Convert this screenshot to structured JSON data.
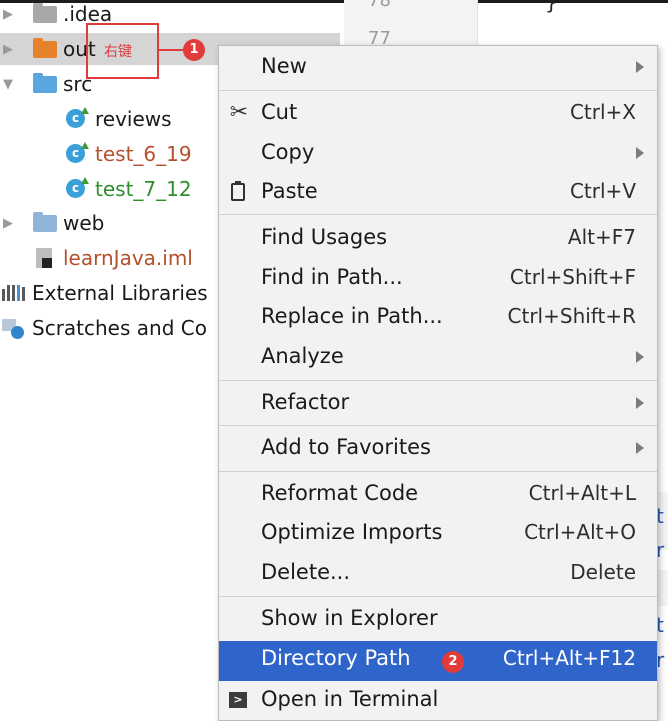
{
  "tree": {
    "items": [
      {
        "label": ".idea",
        "color": "#1a1a1a"
      },
      {
        "label": "out",
        "color": "#1a1a1a"
      },
      {
        "label": "src",
        "color": "#1a1a1a"
      },
      {
        "label": "reviews",
        "color": "#1a1a1a"
      },
      {
        "label": "test_6_19",
        "color": "#b5502c"
      },
      {
        "label": "test_7_12",
        "color": "#2f8f2f"
      },
      {
        "label": "web",
        "color": "#1a1a1a"
      },
      {
        "label": "learnJava.iml",
        "color": "#b5502c"
      },
      {
        "label": "External Libraries",
        "color": "#1a1a1a"
      },
      {
        "label": "Scratches and Co",
        "color": "#1a1a1a"
      }
    ]
  },
  "editor": {
    "line_numbers": [
      "78",
      "77"
    ],
    "brace": "}",
    "fragments": [
      "t",
      "r",
      "t",
      "r"
    ]
  },
  "annotations": {
    "right_click_label": "右键",
    "badge1": "1",
    "badge2": "2"
  },
  "menu": {
    "items": [
      {
        "label": "New",
        "shortcut": "",
        "submenu": true
      },
      {
        "label": "Cut",
        "shortcut": "Ctrl+X",
        "submenu": false,
        "icon": "scissors-icon"
      },
      {
        "label": "Copy",
        "shortcut": "",
        "submenu": true
      },
      {
        "label": "Paste",
        "shortcut": "Ctrl+V",
        "submenu": false,
        "icon": "clipboard-icon"
      },
      {
        "label": "Find Usages",
        "shortcut": "Alt+F7",
        "submenu": false
      },
      {
        "label": "Find in Path...",
        "shortcut": "Ctrl+Shift+F",
        "submenu": false
      },
      {
        "label": "Replace in Path...",
        "shortcut": "Ctrl+Shift+R",
        "submenu": false
      },
      {
        "label": "Analyze",
        "shortcut": "",
        "submenu": true
      },
      {
        "label": "Refactor",
        "shortcut": "",
        "submenu": true
      },
      {
        "label": "Add to Favorites",
        "shortcut": "",
        "submenu": true
      },
      {
        "label": "Reformat Code",
        "shortcut": "Ctrl+Alt+L",
        "submenu": false
      },
      {
        "label": "Optimize Imports",
        "shortcut": "Ctrl+Alt+O",
        "submenu": false
      },
      {
        "label": "Delete...",
        "shortcut": "Delete",
        "submenu": false
      },
      {
        "label": "Show in Explorer",
        "shortcut": "",
        "submenu": false
      },
      {
        "label": "Directory Path",
        "shortcut": "Ctrl+Alt+F12",
        "submenu": false,
        "selected": true
      },
      {
        "label": "Open in Terminal",
        "shortcut": "",
        "submenu": false,
        "icon": "terminal-icon"
      }
    ],
    "highlight_color": "#2f65ca"
  }
}
